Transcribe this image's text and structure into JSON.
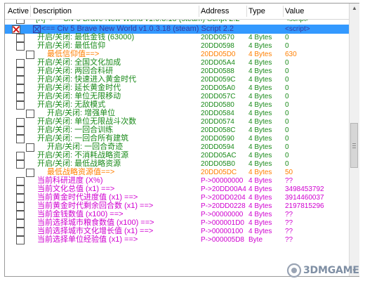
{
  "header": {
    "active": "Active",
    "description": "Description",
    "address": "Address",
    "type": "Type",
    "value": "Value"
  },
  "colors": {
    "selection": "#3399ff",
    "green": "#1a8a1a",
    "orange": "#ff7f00",
    "magenta": "#d000d0",
    "red_x": "#d21414"
  },
  "entries": [
    {
      "active": false,
      "desc": "[X] <== Civ 5 Brave New World v1.0.3.18 (steam) Script 2.2",
      "addr": "",
      "type": "",
      "val": "<script>",
      "color": "#1a8a1a",
      "indent": 0
    },
    {
      "active": true,
      "desc": "[X] <== Civ 5 Brave New World v1.0.3.18 (steam) Script 2.2",
      "addr": "",
      "type": "",
      "val": "<script>",
      "color": "#3a3a9c",
      "indent": 0,
      "selected": false,
      "script": true
    },
    {
      "active": false,
      "desc": "开启/关闭: 最低金钱 (63000)",
      "addr": "20DD0570",
      "type": "4 Bytes",
      "val": "0",
      "color": "#1a8a1a",
      "indent": 1
    },
    {
      "active": false,
      "desc": "开启/关闭: 最低信仰",
      "addr": "20DD0598",
      "type": "4 Bytes",
      "val": "0",
      "color": "#1a8a1a",
      "indent": 1
    },
    {
      "active": false,
      "desc": "最低信仰值==>",
      "addr": "20DD05D0",
      "type": "4 Bytes",
      "val": "630",
      "color": "#ff7f00",
      "indent": 2
    },
    {
      "active": false,
      "desc": "开启/关闭: 全国文化加成",
      "addr": "20DD05A4",
      "type": "4 Bytes",
      "val": "0",
      "color": "#1a8a1a",
      "indent": 1
    },
    {
      "active": false,
      "desc": "开启/关闭: 两回合科研",
      "addr": "20DD0588",
      "type": "4 Bytes",
      "val": "0",
      "color": "#1a8a1a",
      "indent": 1
    },
    {
      "active": false,
      "desc": "开启/关闭: 快速进入黄金时代",
      "addr": "20DD059C",
      "type": "4 Bytes",
      "val": "0",
      "color": "#1a8a1a",
      "indent": 1
    },
    {
      "active": false,
      "desc": "开启/关闭: 延长黄金时代",
      "addr": "20DD05A0",
      "type": "4 Bytes",
      "val": "0",
      "color": "#1a8a1a",
      "indent": 1
    },
    {
      "active": false,
      "desc": "开启/关闭: 单位无限移动",
      "addr": "20DD057C",
      "type": "4 Bytes",
      "val": "0",
      "color": "#1a8a1a",
      "indent": 1
    },
    {
      "active": false,
      "desc": "开启/关闭: 无敌模式",
      "addr": "20DD0580",
      "type": "4 Bytes",
      "val": "0",
      "color": "#1a8a1a",
      "indent": 1
    },
    {
      "active": false,
      "desc": "开启/关闭: 增强单位",
      "addr": "20DD0584",
      "type": "4 Bytes",
      "val": "0",
      "color": "#1a8a1a",
      "indent": 2
    },
    {
      "active": false,
      "desc": "开启/关闭: 单位无限战斗次数",
      "addr": "20DD0574",
      "type": "4 Bytes",
      "val": "0",
      "color": "#1a8a1a",
      "indent": 1
    },
    {
      "active": false,
      "desc": "开启/关闭: 一回合训练",
      "addr": "20DD058C",
      "type": "4 Bytes",
      "val": "0",
      "color": "#1a8a1a",
      "indent": 1
    },
    {
      "active": false,
      "desc": "开启/关闭: 一回合所有建筑",
      "addr": "20DD0590",
      "type": "4 Bytes",
      "val": "0",
      "color": "#1a8a1a",
      "indent": 1
    },
    {
      "active": false,
      "desc": "开启/关闭: 一回合奇迹",
      "addr": "20DD0594",
      "type": "4 Bytes",
      "val": "0",
      "color": "#1a8a1a",
      "indent": 2
    },
    {
      "active": false,
      "desc": "开启/关闭: 不消耗战略资源",
      "addr": "20DD05AC",
      "type": "4 Bytes",
      "val": "0",
      "color": "#1a8a1a",
      "indent": 1
    },
    {
      "active": false,
      "desc": "开启/关闭: 最低战略资源",
      "addr": "20DD05B0",
      "type": "4 Bytes",
      "val": "0",
      "color": "#1a8a1a",
      "indent": 1
    },
    {
      "active": false,
      "desc": "最低战略资源值==>",
      "addr": "20DD05DC",
      "type": "4 Bytes",
      "val": "50",
      "color": "#ff7f00",
      "indent": 2
    },
    {
      "active": false,
      "desc": "当前科研进度 (X%)",
      "addr": "P->00000000",
      "type": "4 Bytes",
      "val": "??",
      "color": "#d000d0",
      "indent": 0
    },
    {
      "active": false,
      "desc": "当前文化总值 (x1) ==>",
      "addr": "P->20DD00A4",
      "type": "4 Bytes",
      "val": "3498453792",
      "color": "#d000d0",
      "indent": 0
    },
    {
      "active": false,
      "desc": "当前黄金时代进度值 (x1) ==>",
      "addr": "P->20DD0204",
      "type": "4 Bytes",
      "val": "3914460037",
      "color": "#d000d0",
      "indent": 0
    },
    {
      "active": false,
      "desc": "当前黄金时代剩余回合数 (x1) ==>",
      "addr": "P->20DD0228",
      "type": "4 Bytes",
      "val": "2197815296",
      "color": "#d000d0",
      "indent": 0
    },
    {
      "active": false,
      "desc": "当前金钱数值 (x100) ==>",
      "addr": "P->00000000",
      "type": "4 Bytes",
      "val": "??",
      "color": "#d000d0",
      "indent": 0
    },
    {
      "active": false,
      "desc": "当前选择城市粮食数值 (x100) ==>",
      "addr": "P->000001D0",
      "type": "4 Bytes",
      "val": "??",
      "color": "#d000d0",
      "indent": 0
    },
    {
      "active": false,
      "desc": "当前选择城市文化增长值 (x1) ==>",
      "addr": "P->00000100",
      "type": "4 Bytes",
      "val": "??",
      "color": "#d000d0",
      "indent": 0
    },
    {
      "active": false,
      "desc": "当前选择单位经验值 (x1) ==>",
      "addr": "P->000005D8",
      "type": "Byte",
      "val": "??",
      "color": "#d000d0",
      "indent": 0
    }
  ],
  "watermark": {
    "text": "3DMGAME"
  },
  "scrollbar": {
    "up_icon": "arrow-up-icon",
    "down_icon": "arrow-down-icon"
  }
}
